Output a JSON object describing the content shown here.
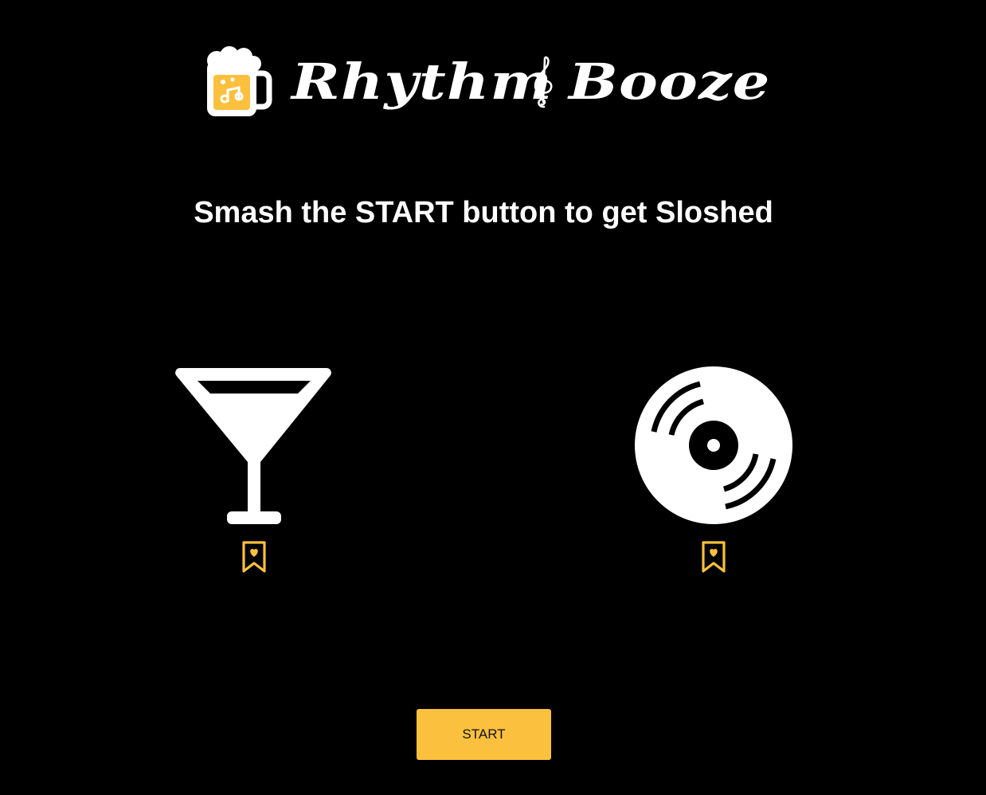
{
  "header": {
    "logo_word_1": "Rhythm",
    "logo_word_2": "Booze",
    "logo_icon": "beer-mug-music-icon",
    "clef_icon": "treble-clef-icon"
  },
  "main": {
    "tagline": "Smash the START button to get Sloshed",
    "cards": [
      {
        "icon": "martini-glass-icon",
        "favorite_icon": "bookmark-heart-icon"
      },
      {
        "icon": "vinyl-record-icon",
        "favorite_icon": "bookmark-heart-icon"
      }
    ],
    "start_label": "START"
  },
  "colors": {
    "background": "#000000",
    "foreground": "#ffffff",
    "accent": "#fbc03d"
  }
}
